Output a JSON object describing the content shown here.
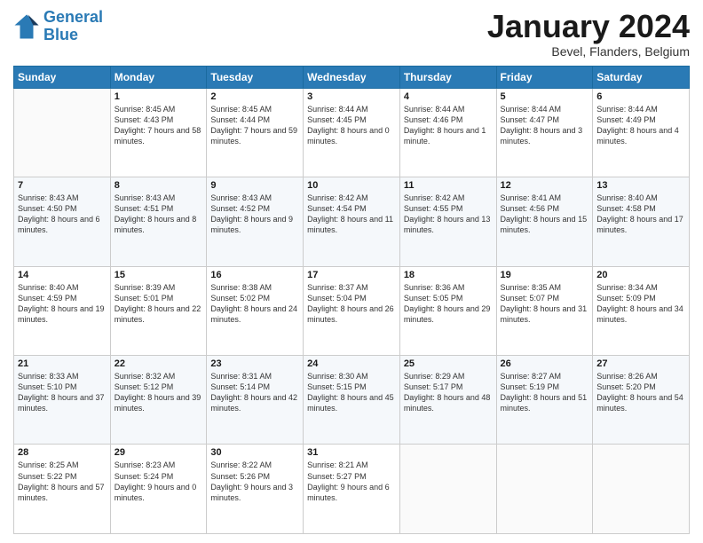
{
  "logo": {
    "line1": "General",
    "line2": "Blue"
  },
  "header": {
    "month": "January 2024",
    "location": "Bevel, Flanders, Belgium"
  },
  "weekdays": [
    "Sunday",
    "Monday",
    "Tuesday",
    "Wednesday",
    "Thursday",
    "Friday",
    "Saturday"
  ],
  "weeks": [
    [
      {
        "day": "",
        "sunrise": "",
        "sunset": "",
        "daylight": ""
      },
      {
        "day": "1",
        "sunrise": "Sunrise: 8:45 AM",
        "sunset": "Sunset: 4:43 PM",
        "daylight": "Daylight: 7 hours and 58 minutes."
      },
      {
        "day": "2",
        "sunrise": "Sunrise: 8:45 AM",
        "sunset": "Sunset: 4:44 PM",
        "daylight": "Daylight: 7 hours and 59 minutes."
      },
      {
        "day": "3",
        "sunrise": "Sunrise: 8:44 AM",
        "sunset": "Sunset: 4:45 PM",
        "daylight": "Daylight: 8 hours and 0 minutes."
      },
      {
        "day": "4",
        "sunrise": "Sunrise: 8:44 AM",
        "sunset": "Sunset: 4:46 PM",
        "daylight": "Daylight: 8 hours and 1 minute."
      },
      {
        "day": "5",
        "sunrise": "Sunrise: 8:44 AM",
        "sunset": "Sunset: 4:47 PM",
        "daylight": "Daylight: 8 hours and 3 minutes."
      },
      {
        "day": "6",
        "sunrise": "Sunrise: 8:44 AM",
        "sunset": "Sunset: 4:49 PM",
        "daylight": "Daylight: 8 hours and 4 minutes."
      }
    ],
    [
      {
        "day": "7",
        "sunrise": "Sunrise: 8:43 AM",
        "sunset": "Sunset: 4:50 PM",
        "daylight": "Daylight: 8 hours and 6 minutes."
      },
      {
        "day": "8",
        "sunrise": "Sunrise: 8:43 AM",
        "sunset": "Sunset: 4:51 PM",
        "daylight": "Daylight: 8 hours and 8 minutes."
      },
      {
        "day": "9",
        "sunrise": "Sunrise: 8:43 AM",
        "sunset": "Sunset: 4:52 PM",
        "daylight": "Daylight: 8 hours and 9 minutes."
      },
      {
        "day": "10",
        "sunrise": "Sunrise: 8:42 AM",
        "sunset": "Sunset: 4:54 PM",
        "daylight": "Daylight: 8 hours and 11 minutes."
      },
      {
        "day": "11",
        "sunrise": "Sunrise: 8:42 AM",
        "sunset": "Sunset: 4:55 PM",
        "daylight": "Daylight: 8 hours and 13 minutes."
      },
      {
        "day": "12",
        "sunrise": "Sunrise: 8:41 AM",
        "sunset": "Sunset: 4:56 PM",
        "daylight": "Daylight: 8 hours and 15 minutes."
      },
      {
        "day": "13",
        "sunrise": "Sunrise: 8:40 AM",
        "sunset": "Sunset: 4:58 PM",
        "daylight": "Daylight: 8 hours and 17 minutes."
      }
    ],
    [
      {
        "day": "14",
        "sunrise": "Sunrise: 8:40 AM",
        "sunset": "Sunset: 4:59 PM",
        "daylight": "Daylight: 8 hours and 19 minutes."
      },
      {
        "day": "15",
        "sunrise": "Sunrise: 8:39 AM",
        "sunset": "Sunset: 5:01 PM",
        "daylight": "Daylight: 8 hours and 22 minutes."
      },
      {
        "day": "16",
        "sunrise": "Sunrise: 8:38 AM",
        "sunset": "Sunset: 5:02 PM",
        "daylight": "Daylight: 8 hours and 24 minutes."
      },
      {
        "day": "17",
        "sunrise": "Sunrise: 8:37 AM",
        "sunset": "Sunset: 5:04 PM",
        "daylight": "Daylight: 8 hours and 26 minutes."
      },
      {
        "day": "18",
        "sunrise": "Sunrise: 8:36 AM",
        "sunset": "Sunset: 5:05 PM",
        "daylight": "Daylight: 8 hours and 29 minutes."
      },
      {
        "day": "19",
        "sunrise": "Sunrise: 8:35 AM",
        "sunset": "Sunset: 5:07 PM",
        "daylight": "Daylight: 8 hours and 31 minutes."
      },
      {
        "day": "20",
        "sunrise": "Sunrise: 8:34 AM",
        "sunset": "Sunset: 5:09 PM",
        "daylight": "Daylight: 8 hours and 34 minutes."
      }
    ],
    [
      {
        "day": "21",
        "sunrise": "Sunrise: 8:33 AM",
        "sunset": "Sunset: 5:10 PM",
        "daylight": "Daylight: 8 hours and 37 minutes."
      },
      {
        "day": "22",
        "sunrise": "Sunrise: 8:32 AM",
        "sunset": "Sunset: 5:12 PM",
        "daylight": "Daylight: 8 hours and 39 minutes."
      },
      {
        "day": "23",
        "sunrise": "Sunrise: 8:31 AM",
        "sunset": "Sunset: 5:14 PM",
        "daylight": "Daylight: 8 hours and 42 minutes."
      },
      {
        "day": "24",
        "sunrise": "Sunrise: 8:30 AM",
        "sunset": "Sunset: 5:15 PM",
        "daylight": "Daylight: 8 hours and 45 minutes."
      },
      {
        "day": "25",
        "sunrise": "Sunrise: 8:29 AM",
        "sunset": "Sunset: 5:17 PM",
        "daylight": "Daylight: 8 hours and 48 minutes."
      },
      {
        "day": "26",
        "sunrise": "Sunrise: 8:27 AM",
        "sunset": "Sunset: 5:19 PM",
        "daylight": "Daylight: 8 hours and 51 minutes."
      },
      {
        "day": "27",
        "sunrise": "Sunrise: 8:26 AM",
        "sunset": "Sunset: 5:20 PM",
        "daylight": "Daylight: 8 hours and 54 minutes."
      }
    ],
    [
      {
        "day": "28",
        "sunrise": "Sunrise: 8:25 AM",
        "sunset": "Sunset: 5:22 PM",
        "daylight": "Daylight: 8 hours and 57 minutes."
      },
      {
        "day": "29",
        "sunrise": "Sunrise: 8:23 AM",
        "sunset": "Sunset: 5:24 PM",
        "daylight": "Daylight: 9 hours and 0 minutes."
      },
      {
        "day": "30",
        "sunrise": "Sunrise: 8:22 AM",
        "sunset": "Sunset: 5:26 PM",
        "daylight": "Daylight: 9 hours and 3 minutes."
      },
      {
        "day": "31",
        "sunrise": "Sunrise: 8:21 AM",
        "sunset": "Sunset: 5:27 PM",
        "daylight": "Daylight: 9 hours and 6 minutes."
      },
      {
        "day": "",
        "sunrise": "",
        "sunset": "",
        "daylight": ""
      },
      {
        "day": "",
        "sunrise": "",
        "sunset": "",
        "daylight": ""
      },
      {
        "day": "",
        "sunrise": "",
        "sunset": "",
        "daylight": ""
      }
    ]
  ]
}
